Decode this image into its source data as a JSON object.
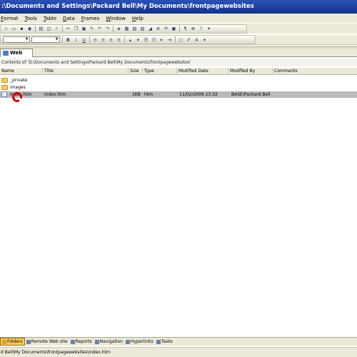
{
  "window": {
    "title": ":\\Documents and Settings\\Packard Bell\\My Documents\\frontpagewebsites"
  },
  "menu": [
    {
      "key": "F",
      "rest": "ormat"
    },
    {
      "key": "T",
      "rest": "ools"
    },
    {
      "key": "T",
      "rest": "able"
    },
    {
      "key": "D",
      "rest": "ata"
    },
    {
      "key": "F",
      "rest": "rames"
    },
    {
      "key": "W",
      "rest": "indow"
    },
    {
      "key": "H",
      "rest": "elp"
    }
  ],
  "format_toolbar": {
    "bold": "B",
    "italic": "I",
    "underline": "U",
    "font_color": "A"
  },
  "tab": {
    "label": "Web Site"
  },
  "path": {
    "text": "Contents of 'D:\\Documents and Settings\\Packard Bell\\My Documents\\frontpagewebsites'"
  },
  "columns": [
    "Name",
    "Title",
    "Size",
    "Type",
    "Modified Date",
    "Modified By",
    "Comments"
  ],
  "rows": [
    {
      "name": "_private",
      "title": "",
      "size": "",
      "type": "",
      "modified": "",
      "by": "",
      "comments": "",
      "kind": "folder"
    },
    {
      "name": "images",
      "title": "",
      "size": "",
      "type": "",
      "modified": "",
      "by": "",
      "comments": "",
      "kind": "folder"
    },
    {
      "name": "index.htm",
      "title": "index.htm",
      "size": "1KB",
      "type": "htm",
      "modified": "11/02/2009 23:32",
      "by": "BASE\\Packard Bell",
      "comments": "",
      "kind": "file",
      "selected": true
    }
  ],
  "views": [
    {
      "label": "Folders",
      "active": true
    },
    {
      "label": "Remote Web site",
      "active": false
    },
    {
      "label": "Reports",
      "active": false
    },
    {
      "label": "Navigation",
      "active": false
    },
    {
      "label": "Hyperlinks",
      "active": false
    },
    {
      "label": "Tasks",
      "active": false
    }
  ],
  "status": {
    "text": "d Bell\\My Documents\\frontpagewebsites\\index.htm"
  }
}
